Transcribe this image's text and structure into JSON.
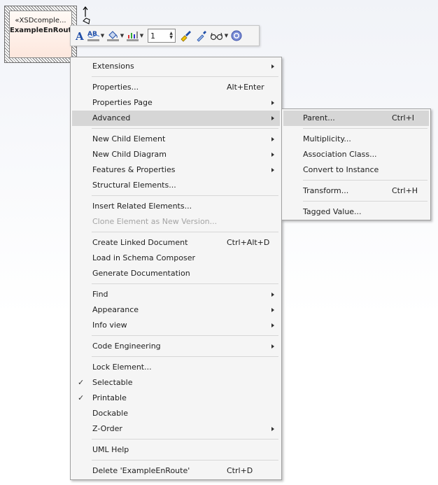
{
  "element": {
    "stereotype": "«XSDcomple...",
    "name": "ExampleEnRoute"
  },
  "toolbar": {
    "line_width": "1",
    "icons": [
      "font-icon",
      "text-color-icon",
      "fill-color-icon",
      "line-color-icon",
      "line-width-stepper",
      "format-painter-icon",
      "eyedropper-icon",
      "glasses-icon",
      "help-icon"
    ]
  },
  "main_menu": {
    "extensions": "Extensions",
    "properties": "Properties...",
    "properties_shortcut": "Alt+Enter",
    "properties_page": "Properties Page",
    "advanced": "Advanced",
    "new_child_element": "New Child Element",
    "new_child_diagram": "New Child Diagram",
    "features_properties": "Features & Properties",
    "structural_elements": "Structural Elements...",
    "insert_related": "Insert Related Elements...",
    "clone_element": "Clone Element as New Version...",
    "create_linked_doc": "Create Linked Document",
    "create_linked_doc_shortcut": "Ctrl+Alt+D",
    "load_schema": "Load in Schema Composer",
    "generate_doc": "Generate Documentation",
    "find": "Find",
    "appearance": "Appearance",
    "info_view": "Info view",
    "code_engineering": "Code Engineering",
    "lock_element": "Lock Element...",
    "selectable": "Selectable",
    "printable": "Printable",
    "dockable": "Dockable",
    "z_order": "Z-Order",
    "uml_help": "UML Help",
    "delete": "Delete 'ExampleEnRoute'",
    "delete_shortcut": "Ctrl+D",
    "check_mark": "✓"
  },
  "sub_menu": {
    "parent": "Parent...",
    "parent_shortcut": "Ctrl+I",
    "multiplicity": "Multiplicity...",
    "association_class": "Association Class...",
    "convert_instance": "Convert to Instance",
    "transform": "Transform...",
    "transform_shortcut": "Ctrl+H",
    "tagged_value": "Tagged Value..."
  },
  "colors": {
    "highlight": "#d6d6d6",
    "menu_bg": "#f5f5f5",
    "element_fill": "#fde7dd",
    "accent_blue": "#1f4ea8"
  }
}
